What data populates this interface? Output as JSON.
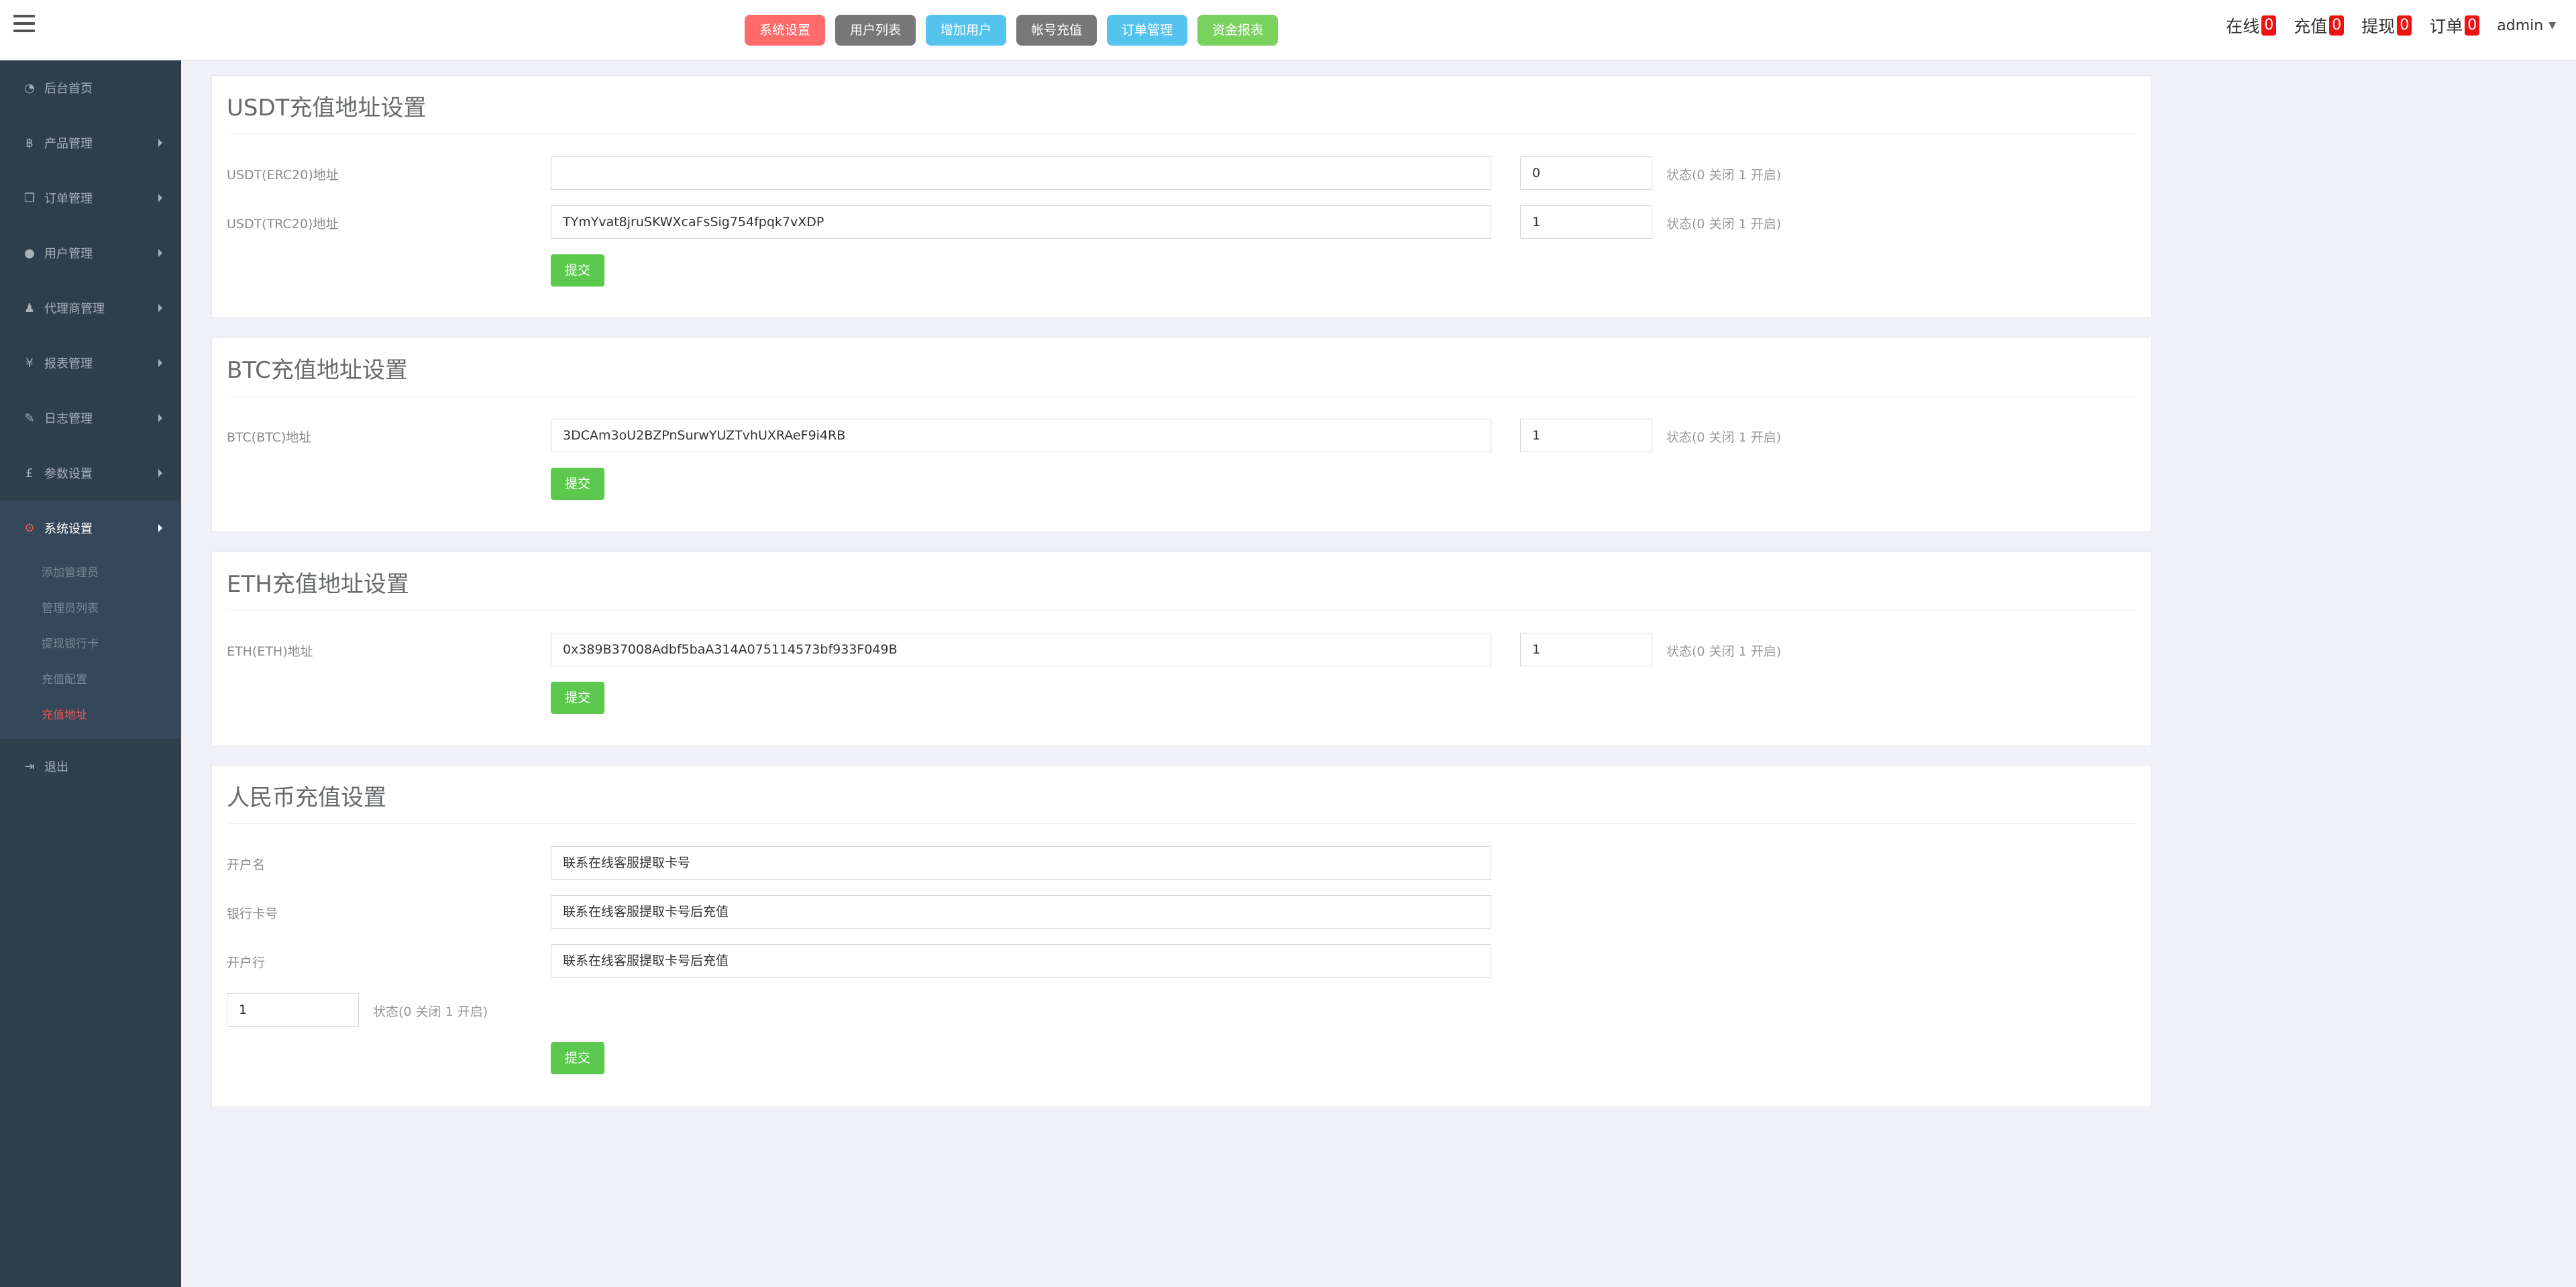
{
  "topbar": {
    "quick_buttons": [
      {
        "label": "系统设置",
        "color": "#ff6b6b"
      },
      {
        "label": "用户列表",
        "color": "#777777"
      },
      {
        "label": "增加用户",
        "color": "#55c3ee"
      },
      {
        "label": "帐号充值",
        "color": "#777777"
      },
      {
        "label": "订单管理",
        "color": "#55c3ee"
      },
      {
        "label": "资金报表",
        "color": "#79d25e"
      }
    ],
    "stats": [
      {
        "label": "在线",
        "count": "0"
      },
      {
        "label": "充值",
        "count": "0"
      },
      {
        "label": "提现",
        "count": "0"
      },
      {
        "label": "订单",
        "count": "0"
      }
    ],
    "user": "admin"
  },
  "sidebar": {
    "items": [
      {
        "label": "后台首页",
        "icon": "dashboard-icon"
      },
      {
        "label": "产品管理",
        "icon": "bitcoin-icon"
      },
      {
        "label": "订单管理",
        "icon": "copy-icon"
      },
      {
        "label": "用户管理",
        "icon": "user-icon"
      },
      {
        "label": "代理商管理",
        "icon": "users-icon"
      },
      {
        "label": "报表管理",
        "icon": "yen-icon"
      },
      {
        "label": "日志管理",
        "icon": "tag-icon"
      },
      {
        "label": "参数设置",
        "icon": "pound-icon"
      },
      {
        "label": "系统设置",
        "icon": "cogs-icon"
      },
      {
        "label": "退出",
        "icon": "sign-out-icon"
      }
    ],
    "sub_items": [
      "添加管理员",
      "管理员列表",
      "提现银行卡",
      "充值配置",
      "充值地址"
    ],
    "active_color": "#ef5350"
  },
  "usdt": {
    "title": "USDT充值地址设置",
    "erc20_label": "USDT(ERC20)地址",
    "erc20_value": "",
    "erc20_status": "0",
    "trc20_label": "USDT(TRC20)地址",
    "trc20_value": "TYmYvat8jruSKWXcaFsSig754fpqk7vXDP",
    "trc20_status": "1",
    "hint": "状态(0 关闭 1 开启)",
    "submit": "提交"
  },
  "btc": {
    "title": "BTC充值地址设置",
    "label": "BTC(BTC)地址",
    "value": "3DCAm3oU2BZPnSurwYUZTvhUXRAeF9i4RB",
    "status": "1",
    "hint": "状态(0 关闭 1 开启)",
    "submit": "提交"
  },
  "eth": {
    "title": "ETH充值地址设置",
    "label": "ETH(ETH)地址",
    "value": "0x389B37008Adbf5baA314A075114573bf933F049B",
    "status": "1",
    "hint": "状态(0 关闭 1 开启)",
    "submit": "提交"
  },
  "rmb": {
    "title": "人民币充值设置",
    "account_name_label": "开户名",
    "account_name_value": "联系在线客服提取卡号",
    "card_no_label": "银行卡号",
    "card_no_value": "联系在线客服提取卡号后充值",
    "bank_label": "开户行",
    "bank_value": "联系在线客服提取卡号后充值",
    "status": "1",
    "hint": "状态(0 关闭 1 开启)",
    "submit": "提交"
  }
}
